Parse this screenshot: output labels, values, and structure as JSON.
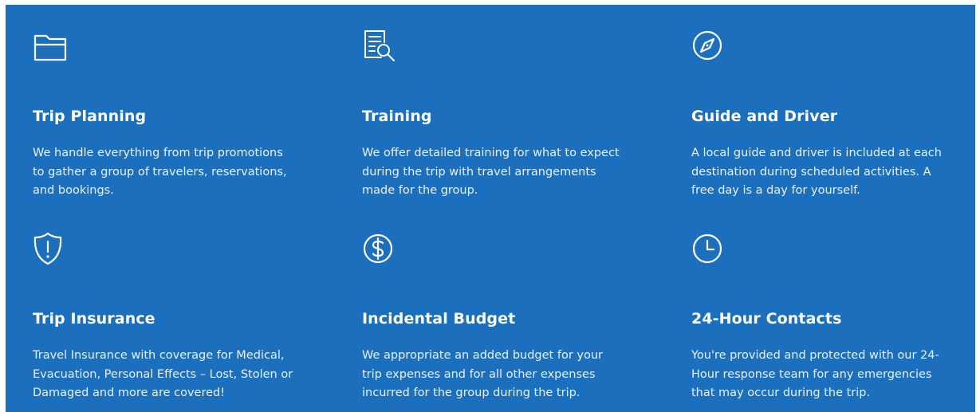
{
  "colors": {
    "background": "#1c6fbd",
    "text": "#ffffff"
  },
  "features": [
    {
      "icon": "folder-icon",
      "title": "Trip Planning",
      "description": "We handle everything from trip promotions\nto gather a group of travelers, reservations,\nand bookings."
    },
    {
      "icon": "document-search-icon",
      "title": "Training",
      "description": "We offer detailed training for what to expect\nduring the trip with travel arrangements\nmade for the group."
    },
    {
      "icon": "compass-icon",
      "title": "Guide and Driver",
      "description": "A local guide and driver is included at each\ndestination during scheduled activities.  A\nfree day is a day for yourself."
    },
    {
      "icon": "shield-alert-icon",
      "title": "Trip Insurance",
      "description": "Travel Insurance with coverage for Medical,\nEvacuation, Personal Effects – Lost, Stolen or\nDamaged and more are covered!"
    },
    {
      "icon": "dollar-circle-icon",
      "title": "Incidental Budget",
      "description": "We appropriate an added budget for your\ntrip expenses and for all other expenses\nincurred for the group during the trip."
    },
    {
      "icon": "clock-icon",
      "title": "24-Hour Contacts",
      "description": "You're provided and protected with our 24-\nHour response team for any emergencies\nthat may occur during the trip."
    }
  ]
}
